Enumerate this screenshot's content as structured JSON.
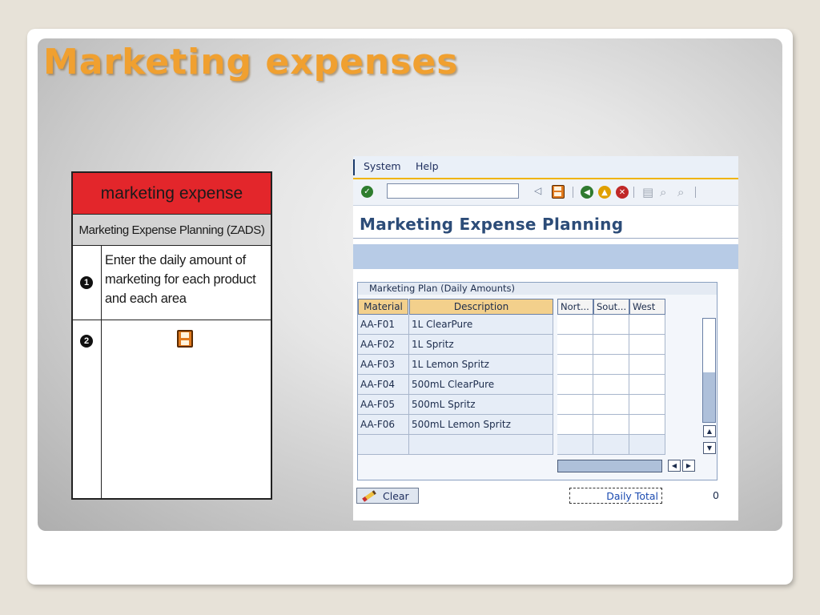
{
  "slide": {
    "title": "Marketing expenses"
  },
  "instructions": {
    "header": "marketing expense",
    "subheader": "Marketing Expense Planning (ZADS)",
    "steps": [
      {
        "num": "1",
        "text": "Enter the daily amount of marketing for each product and each area"
      },
      {
        "num": "2",
        "text": "",
        "icon": "save-icon"
      }
    ]
  },
  "sap": {
    "menu": [
      "System",
      "Help"
    ],
    "title": "Marketing Expense Planning",
    "command_value": "",
    "toolbar_icons": [
      "enter-check-icon",
      "back-triangle-icon",
      "save-icon",
      "back-icon",
      "exit-icon",
      "cancel-icon",
      "print-icon",
      "find-icon",
      "find-next-icon"
    ],
    "group_title": "Marketing Plan (Daily Amounts)",
    "columns": {
      "material": "Material",
      "description": "Description",
      "north": "Nort...",
      "south": "Sout...",
      "west": "West"
    },
    "rows": [
      {
        "material": "AA-F01",
        "description": "1L ClearPure",
        "north": "",
        "south": "",
        "west": ""
      },
      {
        "material": "AA-F02",
        "description": "1L Spritz",
        "north": "",
        "south": "",
        "west": ""
      },
      {
        "material": "AA-F03",
        "description": "1L Lemon Spritz",
        "north": "",
        "south": "",
        "west": ""
      },
      {
        "material": "AA-F04",
        "description": "500mL ClearPure",
        "north": "",
        "south": "",
        "west": ""
      },
      {
        "material": "AA-F05",
        "description": "500mL Spritz",
        "north": "",
        "south": "",
        "west": ""
      },
      {
        "material": "AA-F06",
        "description": "500mL Lemon Spritz",
        "north": "",
        "south": "",
        "west": ""
      }
    ],
    "clear_label": "Clear",
    "daily_total_label": "Daily Total",
    "daily_total_value": "0",
    "colors": {
      "accent": "#f0b400",
      "app_bar": "#b7cbe6",
      "title": "#2c4c78",
      "slide_title": "#f0a030",
      "header_red": "#e3262b"
    }
  }
}
